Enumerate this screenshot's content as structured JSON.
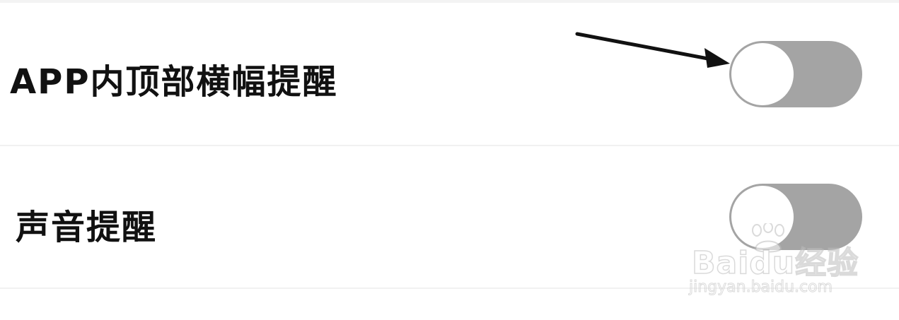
{
  "settings": {
    "rows": [
      {
        "label": "APP内顶部横幅提醒",
        "toggle_on": false
      },
      {
        "label": "声音提醒",
        "toggle_on": false
      }
    ]
  },
  "colors": {
    "toggle_track_off": "#a4a4a4",
    "knob": "#ffffff",
    "text": "#111111",
    "divider": "#f1f1f1"
  },
  "icons": {
    "annotation": "arrow-icon",
    "watermark": "baidu-paw-icon"
  },
  "watermark": {
    "brand": "Baidu经验",
    "url": "jingyan.baidu.com"
  }
}
